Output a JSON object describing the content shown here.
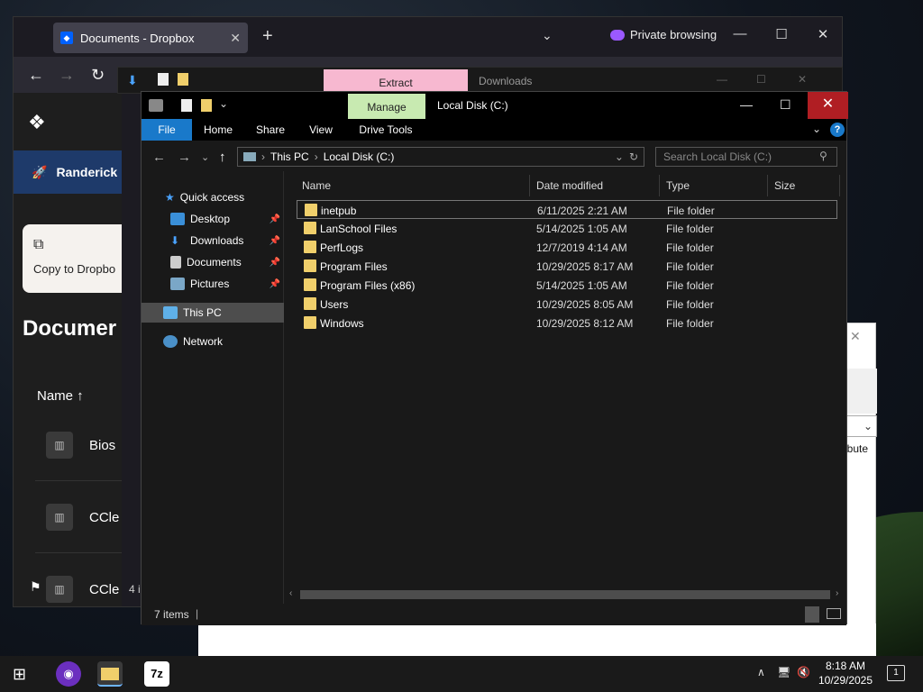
{
  "browser": {
    "tab_title": "Documents - Dropbox",
    "private_label": "Private browsing",
    "team_name": "Randerick",
    "copy_card_label": "Copy to Dropbo",
    "page_heading": "Documer",
    "name_column": "Name ↑",
    "rows": [
      {
        "name": "Bios"
      },
      {
        "name": "CCle"
      },
      {
        "name": "CCle"
      }
    ],
    "footer_count": "4 i"
  },
  "explorer_back": {
    "extract_tab": "Extract",
    "title": "Downloads"
  },
  "explorer": {
    "manage_tab": "Manage",
    "title": "Local Disk (C:)",
    "ribbon_tabs": [
      "File",
      "Home",
      "Share",
      "View",
      "Drive Tools"
    ],
    "breadcrumb": [
      "This PC",
      "Local Disk (C:)"
    ],
    "search_placeholder": "Search Local Disk (C:)",
    "nav": {
      "quick_access": "Quick access",
      "desktop": "Desktop",
      "downloads": "Downloads",
      "documents": "Documents",
      "pictures": "Pictures",
      "this_pc": "This PC",
      "network": "Network"
    },
    "columns": {
      "name": "Name",
      "date": "Date modified",
      "type": "Type",
      "size": "Size"
    },
    "files": [
      {
        "name": "inetpub",
        "date": "6/11/2025 2:21 AM",
        "type": "File folder"
      },
      {
        "name": "LanSchool Files",
        "date": "5/14/2025 1:05 AM",
        "type": "File folder"
      },
      {
        "name": "PerfLogs",
        "date": "12/7/2019 4:14 AM",
        "type": "File folder"
      },
      {
        "name": "Program Files",
        "date": "10/29/2025 8:17 AM",
        "type": "File folder"
      },
      {
        "name": "Program Files (x86)",
        "date": "5/14/2025 1:05 AM",
        "type": "File folder"
      },
      {
        "name": "Users",
        "date": "10/29/2025 8:05 AM",
        "type": "File folder"
      },
      {
        "name": "Windows",
        "date": "10/29/2025 8:12 AM",
        "type": "File folder"
      }
    ],
    "status": "7 items"
  },
  "dialog_fragment": "ribute",
  "taskbar": {
    "time": "8:18 AM",
    "date": "10/29/2025",
    "notifications": "1",
    "sevenzip_label": "7z"
  },
  "colors": {
    "accent": "#1979ca",
    "manage_tab": "#c8eab1",
    "extract_tab": "#f7b8d0",
    "close_red": "#b01e23",
    "folder": "#f0cf6b"
  }
}
